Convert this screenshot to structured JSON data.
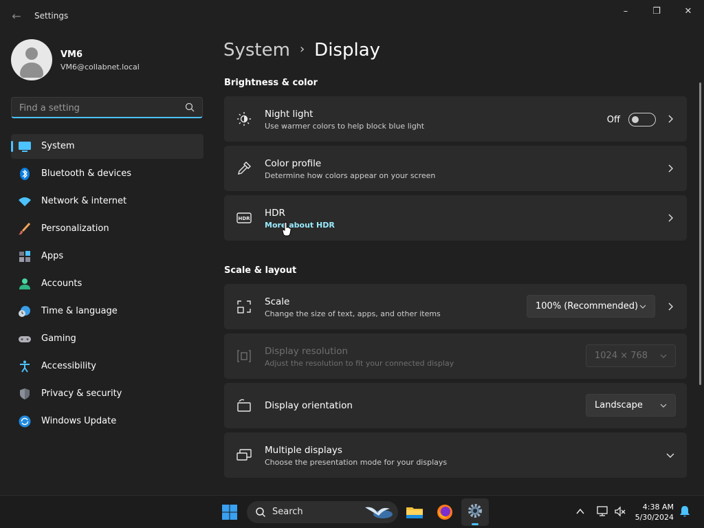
{
  "window": {
    "title": "Settings",
    "minimize": "–",
    "maximize": "❐",
    "close": "✕",
    "back": "←"
  },
  "profile": {
    "name": "VM6",
    "email": "VM6@collabnet.local"
  },
  "search": {
    "placeholder": "Find a setting"
  },
  "nav": {
    "items": [
      {
        "label": "System"
      },
      {
        "label": "Bluetooth & devices"
      },
      {
        "label": "Network & internet"
      },
      {
        "label": "Personalization"
      },
      {
        "label": "Apps"
      },
      {
        "label": "Accounts"
      },
      {
        "label": "Time & language"
      },
      {
        "label": "Gaming"
      },
      {
        "label": "Accessibility"
      },
      {
        "label": "Privacy & security"
      },
      {
        "label": "Windows Update"
      }
    ]
  },
  "breadcrumb": {
    "parent": "System",
    "separator": "›",
    "current": "Display"
  },
  "sections": {
    "brightness": "Brightness & color",
    "scale": "Scale & layout"
  },
  "cards": {
    "night_light": {
      "title": "Night light",
      "subtitle": "Use warmer colors to help block blue light",
      "state": "Off"
    },
    "color_profile": {
      "title": "Color profile",
      "subtitle": "Determine how colors appear on your screen"
    },
    "hdr": {
      "title": "HDR",
      "link": "More about HDR"
    },
    "scale": {
      "title": "Scale",
      "subtitle": "Change the size of text, apps, and other items",
      "value": "100% (Recommended)"
    },
    "resolution": {
      "title": "Display resolution",
      "subtitle": "Adjust the resolution to fit your connected display",
      "value": "1024 × 768"
    },
    "orientation": {
      "title": "Display orientation",
      "value": "Landscape"
    },
    "multiple": {
      "title": "Multiple displays",
      "subtitle": "Choose the presentation mode for your displays"
    }
  },
  "taskbar": {
    "search_label": "Search",
    "time": "4:38 AM",
    "date": "5/30/2024"
  },
  "colors": {
    "accent": "#4cc2ff",
    "background": "#202020",
    "card": "#2b2b2b",
    "link": "#99ebff"
  }
}
